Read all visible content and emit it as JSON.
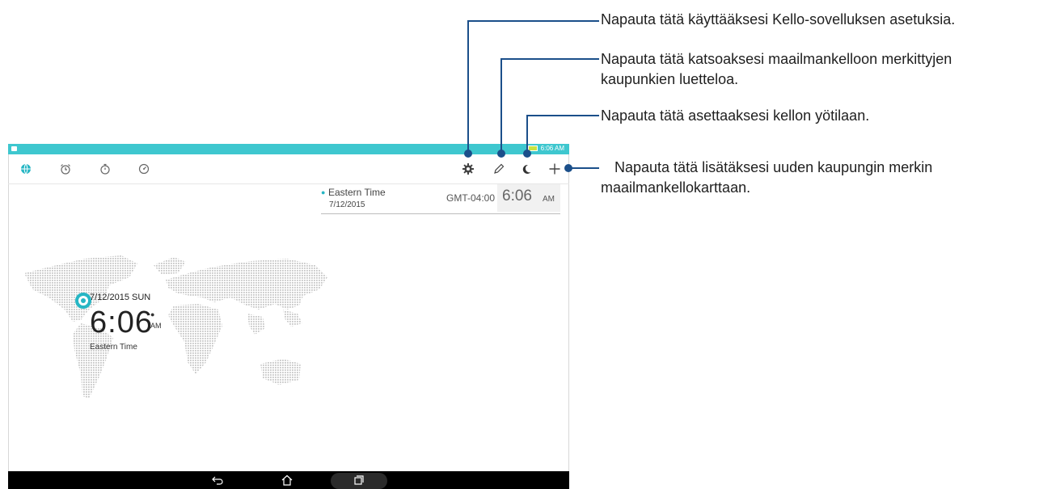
{
  "status_bar": {
    "time": "6:06 AM"
  },
  "tabs": [
    {
      "name": "world-clock",
      "icon": "globe-icon",
      "active": true
    },
    {
      "name": "alarm",
      "icon": "alarm-clock-icon",
      "active": false
    },
    {
      "name": "stopwatch",
      "icon": "stopwatch-icon",
      "active": false
    },
    {
      "name": "timer",
      "icon": "timer-icon",
      "active": false
    }
  ],
  "actions": [
    {
      "name": "settings",
      "icon": "gear-icon"
    },
    {
      "name": "edit",
      "icon": "pencil-icon"
    },
    {
      "name": "night-mode",
      "icon": "moon-icon"
    },
    {
      "name": "add-city",
      "icon": "plus-icon"
    }
  ],
  "city_card": {
    "city": "Eastern Time",
    "date": "7/12/2015",
    "gmt": "GMT-04:00",
    "time": "6:06",
    "ampm": "AM"
  },
  "map_clock": {
    "date": "7/12/2015 SUN",
    "time": "6:06",
    "ampm": "AM",
    "city": "Eastern Time"
  },
  "nav": {
    "back": "back-icon",
    "home": "home-icon",
    "recent": "recent-apps-icon"
  },
  "annotations": [
    {
      "line1": "Napauta tätä käyttääksesi Kello-sovelluksen asetuksia.",
      "line2": ""
    },
    {
      "line1": "Napauta tätä katsoaksesi maailmankelloon merkittyjen",
      "line2": "kaupunkien luetteloa."
    },
    {
      "line1": "Napauta tätä asettaaksesi kellon yötilaan.",
      "line2": ""
    },
    {
      "line1": "Napauta tätä lisätäksesi uuden kaupungin merkin",
      "line2": "maailmankellokarttaan."
    }
  ],
  "colors": {
    "accent": "#26b6c4",
    "status_bar": "#3ec7cf",
    "callout": "#1b4f8a"
  }
}
